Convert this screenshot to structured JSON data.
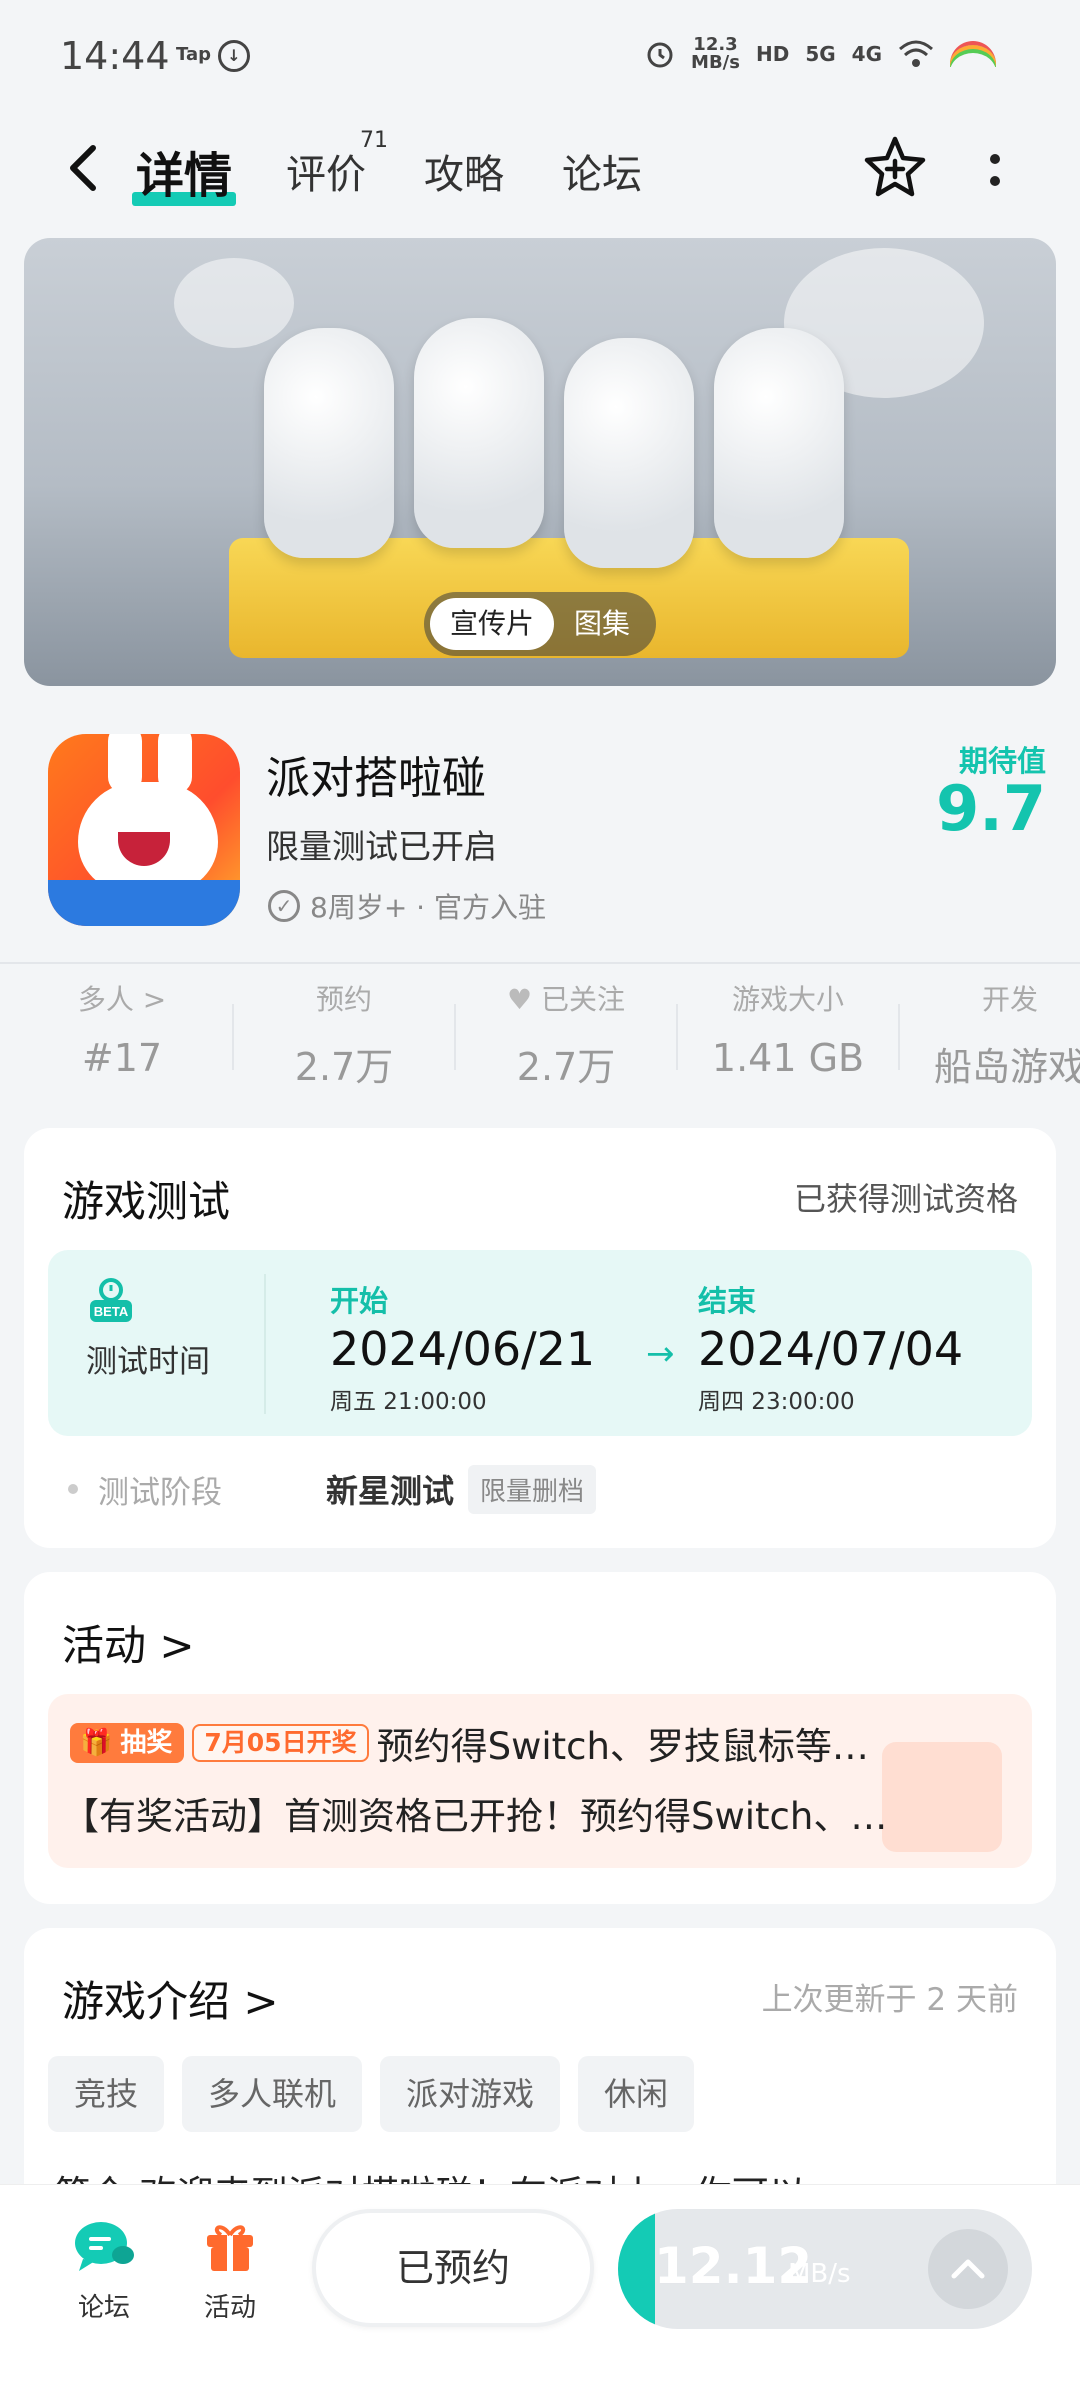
{
  "status_bar": {
    "time": "14:44",
    "tap_label": "Tap",
    "speed_value": "12.3",
    "speed_unit": "MB/s",
    "hd_label": "HD",
    "net1": "5G",
    "net2": "4G"
  },
  "nav": {
    "tabs": [
      {
        "label": "详情",
        "active": true
      },
      {
        "label": "评价",
        "badge": "71"
      },
      {
        "label": "攻略"
      },
      {
        "label": "论坛"
      }
    ]
  },
  "banner": {
    "switch": [
      "宣传片",
      "图集"
    ],
    "selected": "宣传片"
  },
  "app": {
    "name": "派对搭啦碰",
    "subtitle": "限量测试已开启",
    "meta": "8周岁+ · 官方入驻",
    "expect_label": "期待值",
    "expect_value": "9.7"
  },
  "stats": [
    {
      "label": "多人 >",
      "value": "#17"
    },
    {
      "label": "预约",
      "value": "2.7万"
    },
    {
      "label": "已关注",
      "value": "2.7万"
    },
    {
      "label": "游戏大小",
      "value": "1.41 GB"
    },
    {
      "label": "开发",
      "value": "船岛游戏"
    }
  ],
  "test": {
    "title": "游戏测试",
    "status": "已获得测试资格",
    "badge": "BETA",
    "time_label": "测试时间",
    "start_label": "开始",
    "start_date": "2024/06/21",
    "start_time": "周五  21:00:00",
    "end_label": "结束",
    "end_date": "2024/07/04",
    "end_time": "周四  23:00:00",
    "stage_label": "测试阶段",
    "stage_name": "新星测试",
    "stage_tag": "限量删档"
  },
  "activity": {
    "title": "活动 >",
    "lottery_tag": "抽奖",
    "date_tag": "7月05日开奖",
    "line1": "预约得Switch、罗技鼠标等…",
    "line2": "【有奖活动】首测资格已开抢！预约得Switch、…"
  },
  "intro": {
    "title": "游戏介绍 >",
    "update": "上次更新于 2 天前",
    "tags": [
      "竞技",
      "多人联机",
      "派对游戏",
      "休闲"
    ],
    "text": "简介 欢迎来到派对搭啦碰！在派对上，你可以"
  },
  "bottom": {
    "forum_label": "论坛",
    "activity_label": "活动",
    "reserved_label": "已预约",
    "download_speed": "12.12",
    "download_unit": "MB/s",
    "download_progress": 0.09
  },
  "colors": {
    "accent": "#14cbb5",
    "orange": "#ff7b3d"
  }
}
